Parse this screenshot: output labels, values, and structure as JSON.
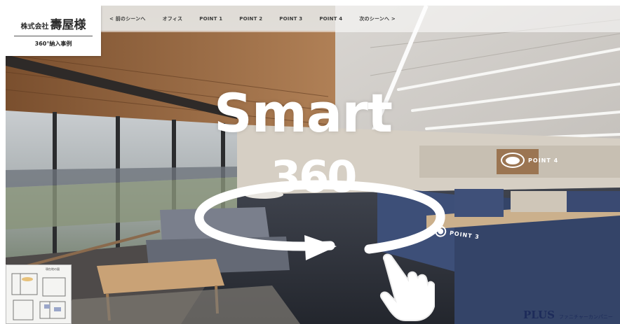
{
  "header": {
    "company_prefix": "株式会社",
    "company_name": "壽屋様",
    "subtitle": "360°納入事例"
  },
  "nav": {
    "items": [
      {
        "label": "< 前のシーンへ"
      },
      {
        "label": "オフィス"
      },
      {
        "label": "POINT 1"
      },
      {
        "label": "POINT 2"
      },
      {
        "label": "POINT 3"
      },
      {
        "label": "POINT 4"
      },
      {
        "label": "次のシーンへ >"
      }
    ]
  },
  "overlay": {
    "word": "Smart",
    "degrees": "360",
    "arrow_icon": "rotate-360-arrow-icon",
    "hand_icon": "pointing-hand-icon"
  },
  "hotspots": {
    "point3": {
      "label": "POINT 3"
    },
    "point4": {
      "label": "POINT 4"
    }
  },
  "minimap": {
    "caption": "現在地の図"
  },
  "footer": {
    "brand": "PLUS",
    "division": "ファニチャーカンパニー"
  },
  "colors": {
    "overlay_text": "#ffffff",
    "nav_text": "#3b3b3b",
    "brand_navy": "#1d2b5a",
    "partition_blue": "#3d4f78",
    "ceiling_wood": "#9a6b45"
  }
}
